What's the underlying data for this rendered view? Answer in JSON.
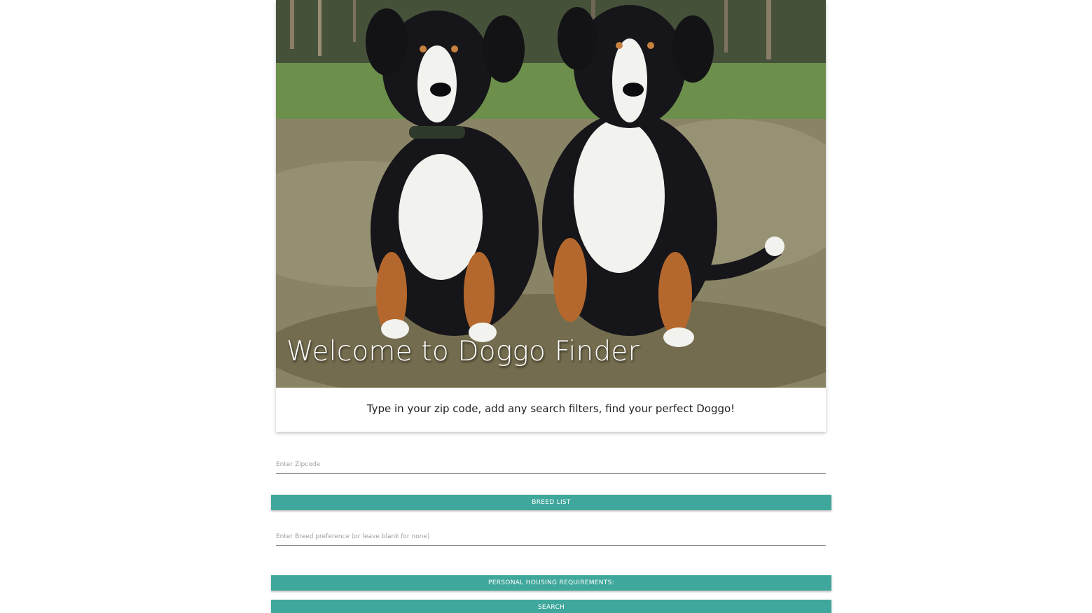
{
  "hero": {
    "title": "Welcome to Doggo Finder",
    "image": "two-dogs-sitting-on-grass-photo"
  },
  "card": {
    "text": "Type in your zip code, add any search filters, find your perfect Doggo!"
  },
  "form": {
    "zipcode_placeholder": "Enter Zipcode",
    "breed_list_label": "BREED LIST",
    "breed_placeholder": "Enter Breed preference (or leave blank for none)",
    "housing_label": "PERSONAL HOUSING REQUIREMENTS:",
    "search_label": "SEARCH"
  },
  "colors": {
    "button": "#40a79c",
    "button_text": "#ffffff"
  }
}
